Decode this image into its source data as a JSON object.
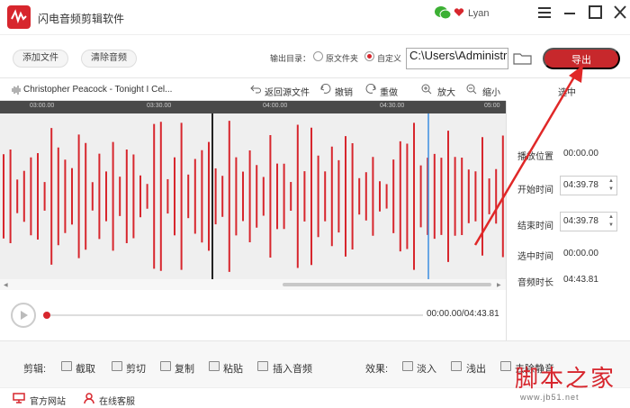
{
  "app": {
    "title": "闪电音频剪辑软件",
    "user": "Lyan"
  },
  "toolbar": {
    "add_file": "添加文件",
    "clear_audio": "清除音频",
    "output_label": "输出目录：",
    "original_folder": "原文件夹",
    "custom": "自定义",
    "output_path": "C:\\Users\\Administrator",
    "export": "导出"
  },
  "editbar": {
    "track_name": "Christopher Peacock - Tonight I Cel...",
    "return_source": "返回源文件",
    "undo": "撤销",
    "redo": "重做",
    "zoom_in": "放大",
    "zoom_out": "缩小",
    "selected_header": "选中"
  },
  "ruler": {
    "ticks": [
      "03:00.00",
      "03:30.00",
      "04:00.00",
      "04:30.00",
      "05:00"
    ]
  },
  "info": {
    "play_position_label": "播放位置",
    "play_position": "00:00.00",
    "start_time_label": "开始时间",
    "start_time": "04:39.78",
    "end_time_label": "结束时间",
    "end_time": "04:39.78",
    "selected_time_label": "选中时间",
    "selected_time": "00:00.00",
    "duration_label": "音频时长",
    "duration": "04:43.81"
  },
  "player": {
    "time_readout": "00:00.00/04:43.81",
    "progress": 0
  },
  "edit_tools": {
    "label": "剪辑:",
    "cut_out": "截取",
    "cut": "剪切",
    "copy": "复制",
    "paste": "粘贴",
    "insert_audio": "插入音频"
  },
  "effects": {
    "label": "效果:",
    "fade_in": "淡入",
    "fade_out": "浅出",
    "remove_silence": "去除静音"
  },
  "footer": {
    "website": "官方网站",
    "service": "在线客服"
  },
  "watermark": {
    "brand": "脚本之家",
    "url": "www.jb51.net"
  },
  "colors": {
    "accent": "#d7262d",
    "waveform": "#d7262d",
    "ruler": "#4a4a4a",
    "selection_line": "#3b8de0"
  }
}
